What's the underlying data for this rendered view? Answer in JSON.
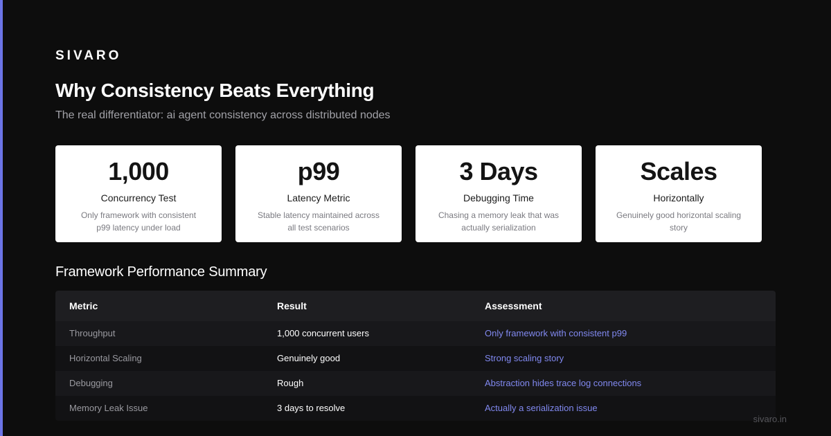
{
  "brand": "SIVARO",
  "title": "Why Consistency Beats Everything",
  "subtitle": "The real differentiator: ai agent consistency across distributed nodes",
  "cards": [
    {
      "value": "1,000",
      "label": "Concurrency Test",
      "desc": "Only framework with consistent p99 latency under load"
    },
    {
      "value": "p99",
      "label": "Latency Metric",
      "desc": "Stable latency maintained across all test scenarios"
    },
    {
      "value": "3 Days",
      "label": "Debugging Time",
      "desc": "Chasing a memory leak that was actually serialization"
    },
    {
      "value": "Scales",
      "label": "Horizontally",
      "desc": "Genuinely good horizontal scaling story"
    }
  ],
  "table": {
    "title": "Framework Performance Summary",
    "headers": [
      "Metric",
      "Result",
      "Assessment"
    ],
    "rows": [
      {
        "metric": "Throughput",
        "result": "1,000 concurrent users",
        "assessment": "Only framework with consistent p99"
      },
      {
        "metric": "Horizontal Scaling",
        "result": "Genuinely good",
        "assessment": "Strong scaling story"
      },
      {
        "metric": "Debugging",
        "result": "Rough",
        "assessment": "Abstraction hides trace log connections"
      },
      {
        "metric": "Memory Leak Issue",
        "result": "3 days to resolve",
        "assessment": "Actually a serialization issue"
      }
    ]
  },
  "footer": "sivaro.in",
  "colors": {
    "accent": "#6b74e6",
    "background": "#0d0d0d",
    "link": "#8189f0"
  }
}
